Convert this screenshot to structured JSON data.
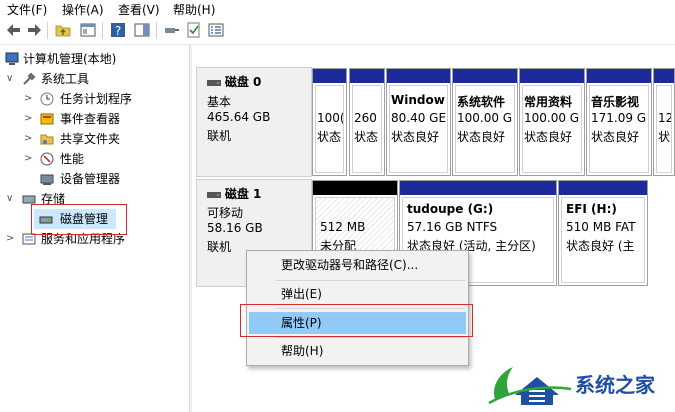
{
  "menubar": {
    "items": [
      "文件(F)",
      "操作(A)",
      "查看(V)",
      "帮助(H)"
    ]
  },
  "toolbar": {
    "icons": [
      "back-arrow-icon",
      "forward-arrow-icon",
      "folder-up-icon",
      "console-tree-icon",
      "help-icon",
      "help-pane-icon",
      "connect-icon",
      "check-icon",
      "properties-list-icon"
    ]
  },
  "tree": {
    "root": "计算机管理(本地)",
    "system_tools": "系统工具",
    "task_scheduler": "任务计划程序",
    "event_viewer": "事件查看器",
    "shared_folders": "共享文件夹",
    "performance": "性能",
    "device_manager": "设备管理器",
    "storage": "存储",
    "disk_management": "磁盘管理",
    "services_apps": "服务和应用程序"
  },
  "disks": [
    {
      "name": "磁盘 0",
      "type": "基本",
      "size": "465.64 GB",
      "status": "联机",
      "partitions": [
        {
          "line1": "100(",
          "line2": "状态"
        },
        {
          "line1": "260",
          "line2": "状态"
        },
        {
          "title": "Window",
          "line1": "80.40 GE",
          "line2": "状态良好"
        },
        {
          "title": "系统软件",
          "line1": "100.00 G",
          "line2": "状态良好"
        },
        {
          "title": "常用资料",
          "line1": "100.00 G",
          "line2": "状态良好"
        },
        {
          "title": "音乐影视",
          "line1": "171.09 G",
          "line2": "状态良好"
        },
        {
          "line1": "12",
          "line2": "状"
        }
      ]
    },
    {
      "name": "磁盘 1",
      "type": "可移动",
      "size": "58.16 GB",
      "status": "联机",
      "partitions": [
        {
          "line1": "512 MB",
          "line2": "未分配"
        },
        {
          "title": "tudoupe  (G:)",
          "line1": "57.16 GB NTFS",
          "line2": "状态良好 (活动, 主分区)"
        },
        {
          "title": "EFI  (H:)",
          "line1": "510 MB FAT",
          "line2": "状态良好 (主"
        }
      ]
    }
  ],
  "context_menu": {
    "items": [
      "更改驱动器号和路径(C)...",
      "弹出(E)",
      "属性(P)",
      "帮助(H)"
    ],
    "selected": "属性(P)"
  },
  "watermark": {
    "text": "系统之家"
  },
  "colors": {
    "partition_bar": "#1c2a9a",
    "unallocated_bar": "#000000",
    "menu_highlight": "#91c9f7",
    "annotation_red": "#d52b2b"
  }
}
